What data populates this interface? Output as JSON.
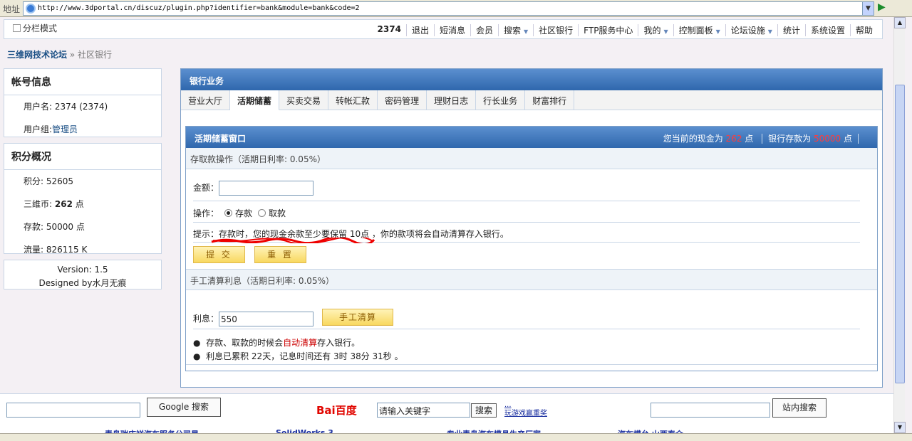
{
  "address": {
    "label": "地址",
    "url": "http://www.3dportal.cn/discuz/plugin.php?identifier=bank&module=bank&code=2"
  },
  "topnav": {
    "mode": "分栏模式",
    "user": "2374",
    "items": [
      "退出",
      "短消息",
      "会员",
      "搜索",
      "社区银行",
      "FTP服务中心",
      "我的",
      "控制面板",
      "论坛设施",
      "统计",
      "系统设置",
      "帮助"
    ]
  },
  "breadcrumb": {
    "home": "三维网技术论坛",
    "sep": "»",
    "current": "社区银行"
  },
  "account": {
    "title": "帐号信息",
    "username_label": "用户名:",
    "username": "2374 (2374)",
    "group_label": "用户组:",
    "group": "管理员"
  },
  "points": {
    "title": "积分概况",
    "credits": "积分: 52605",
    "coins_label": "三维币:",
    "coins": "262",
    "coins_unit": "点",
    "deposit": "存款: 50000 点",
    "traffic": "流量: 826115 K"
  },
  "version": {
    "line1": "Version: 1.5",
    "line2": "Designed by水月无痕"
  },
  "bank": {
    "header": "银行业务",
    "tabs": [
      "营业大厅",
      "活期储蓄",
      "买卖交易",
      "转帐汇款",
      "密码管理",
      "理财日志",
      "行长业务",
      "财富排行"
    ],
    "window_title": "活期储蓄窗口",
    "cash_label": "您当前的现金为",
    "cash": "262",
    "cash_unit": "点",
    "bank_label": "银行存款为",
    "bank_value": "50000",
    "bank_unit": "点"
  },
  "deposit_form": {
    "section": "存取款操作（活期日利率: 0.05%）",
    "amount_label": "金额：",
    "amount_value": "",
    "op_label": "操作：",
    "op_deposit": "存款",
    "op_withdraw": "取款",
    "tip": "提示：存款时，您的现金余款至少要保留 10点 ，你的款项将会自动清算存入银行。",
    "submit": "提 交",
    "reset": "重 置"
  },
  "interest_form": {
    "section": "手工清算利息（活期日利率: 0.05%）",
    "interest_label": "利息：",
    "interest_value": "550",
    "settle": "手工清算",
    "note1_a": "存款、取款的时候会",
    "note1_link": "自动清算",
    "note1_b": "存入银行。",
    "note2": "利息已累积 22天，记息时间还有 3时 38分 31秒 。"
  },
  "footer": {
    "google_btn": "Google 搜索",
    "baidu_logo": "Bai百度",
    "baidu_input": "请输入关键字",
    "baidu_btn": "搜索",
    "site_btn": "站内搜索",
    "tiny_links": [
      "...",
      "玩游戏赢重奖"
    ],
    "marquee": [
      "青岛瑞庄祥汽车服务公司是",
      "SolidWorks 3",
      "专业青岛汽车模具生产厂家",
      "汽车模台 山西泰介"
    ]
  }
}
